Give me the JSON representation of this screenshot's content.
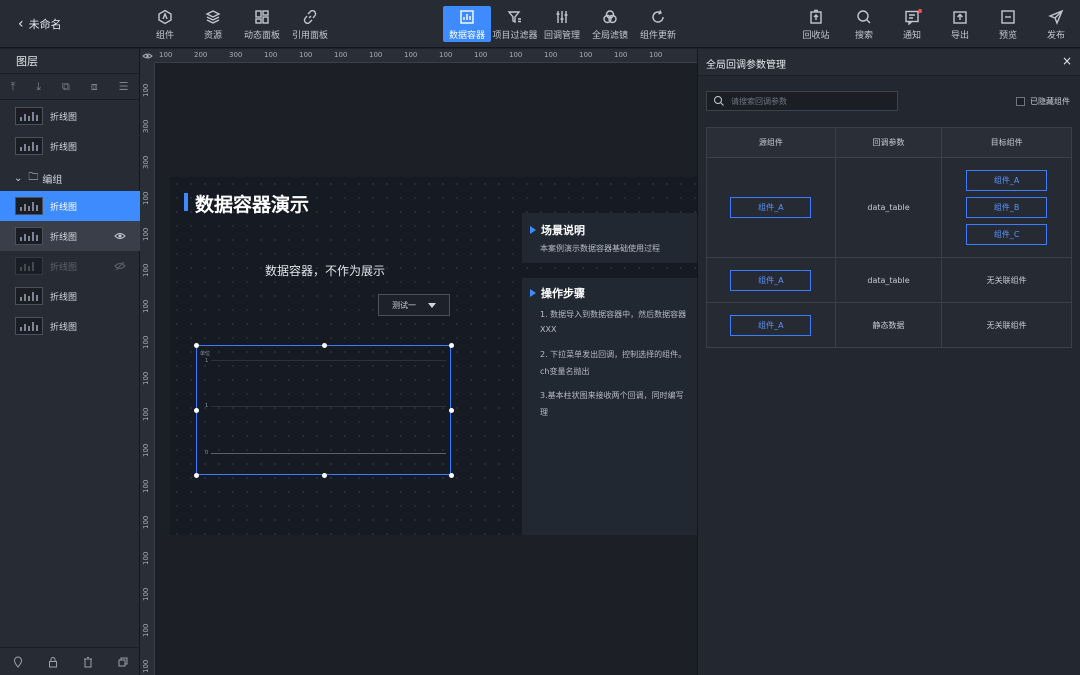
{
  "header": {
    "back_label": "未命名",
    "tools": [
      {
        "label": "组件",
        "icon": "component-icon"
      },
      {
        "label": "资源",
        "icon": "layers-icon"
      },
      {
        "label": "动态面板",
        "icon": "panel-icon"
      },
      {
        "label": "引用面板",
        "icon": "link-icon"
      },
      {
        "label": "数据容器",
        "icon": "data-container-icon",
        "active": true
      },
      {
        "label": "项目过滤器",
        "icon": "filter-icon"
      },
      {
        "label": "回调管理",
        "icon": "sliders-icon"
      },
      {
        "label": "全局滤镜",
        "icon": "filter-lens-icon"
      },
      {
        "label": "组件更新",
        "icon": "refresh-icon"
      }
    ],
    "right_tools": [
      {
        "label": "回收站",
        "icon": "trash-icon"
      },
      {
        "label": "搜索",
        "icon": "search-icon"
      },
      {
        "label": "通知",
        "icon": "notice-icon"
      },
      {
        "label": "导出",
        "icon": "export-icon"
      },
      {
        "label": "预览",
        "icon": "preview-icon"
      },
      {
        "label": "发布",
        "icon": "send-icon"
      }
    ]
  },
  "layers": {
    "title": "图层",
    "items": [
      "折线图",
      "折线图",
      "折线图",
      "折线图",
      "折线图",
      "折线图",
      "折线图"
    ],
    "group_label": "编组"
  },
  "ruler": {
    "top": [
      "100",
      "200",
      "300",
      "100",
      "100",
      "100",
      "100",
      "100",
      "100",
      "100",
      "100",
      "100",
      "100",
      "100",
      "100"
    ],
    "left": [
      "100",
      "300",
      "300",
      "100",
      "100",
      "100",
      "100",
      "100",
      "100",
      "100",
      "100",
      "100",
      "100",
      "100",
      "100",
      "100",
      "100"
    ]
  },
  "stage": {
    "title": "数据容器演示",
    "subtitle": "数据容器，不作为展示",
    "select_value": "测试一",
    "chart_label": "单位",
    "ticks": [
      "1",
      "1",
      "0"
    ],
    "scene": {
      "title": "场景说明",
      "text": "本案例演示数据容器基础使用过程"
    },
    "steps": {
      "title": "操作步骤",
      "lines": [
        "1. 数据导入到数据容器中，然后数据容器",
        "XXX",
        "2. 下拉菜单发出回调，控制选择的组件。",
        "ch变量名抛出",
        "3.基本柱状图来接收两个回调，同时编写",
        "理"
      ]
    }
  },
  "callback_panel": {
    "title": "全局回调参数管理",
    "close": "×",
    "search_placeholder": "请搜索回调参数",
    "hide_label": "已隐藏组件",
    "columns": [
      "源组件",
      "回调参数",
      "目标组件"
    ],
    "rows": [
      {
        "source": "组件_A",
        "param": "data_table",
        "targets": [
          "组件_A",
          "组件_B",
          "组件_C"
        ]
      },
      {
        "source": "组件_A",
        "param": "data_table",
        "targets_text": "无关联组件"
      },
      {
        "source": "组件_A",
        "param": "静态数据",
        "targets_text": "无关联组件"
      }
    ]
  }
}
